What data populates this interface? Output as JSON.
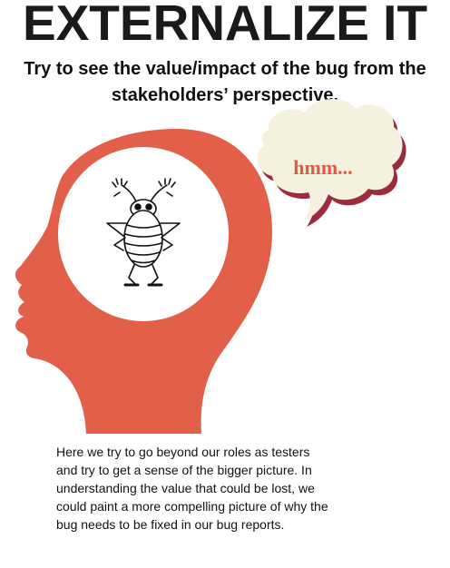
{
  "title": "EXTERNALIZE IT",
  "subtitle": "Try to see the value/impact of the bug from the stakeholders’ perspective.",
  "thought_bubble": {
    "text": "hmm..."
  },
  "illustration": {
    "head_icon": "head-silhouette-icon",
    "bug_icon": "cartoon-bug-icon",
    "thought_icon": "thought-bubble-icon"
  },
  "colors": {
    "head": "#e2604a",
    "bubble_fill": "#f5f1df",
    "bubble_shadow": "#9e2a40",
    "thought_text": "#e25a43"
  },
  "body_text": "Here we try to go beyond our roles as testers and try to get a sense of the bigger picture. In understanding the value that could be lost, we could paint a more compelling picture of why the bug needs to be fixed in our bug reports."
}
